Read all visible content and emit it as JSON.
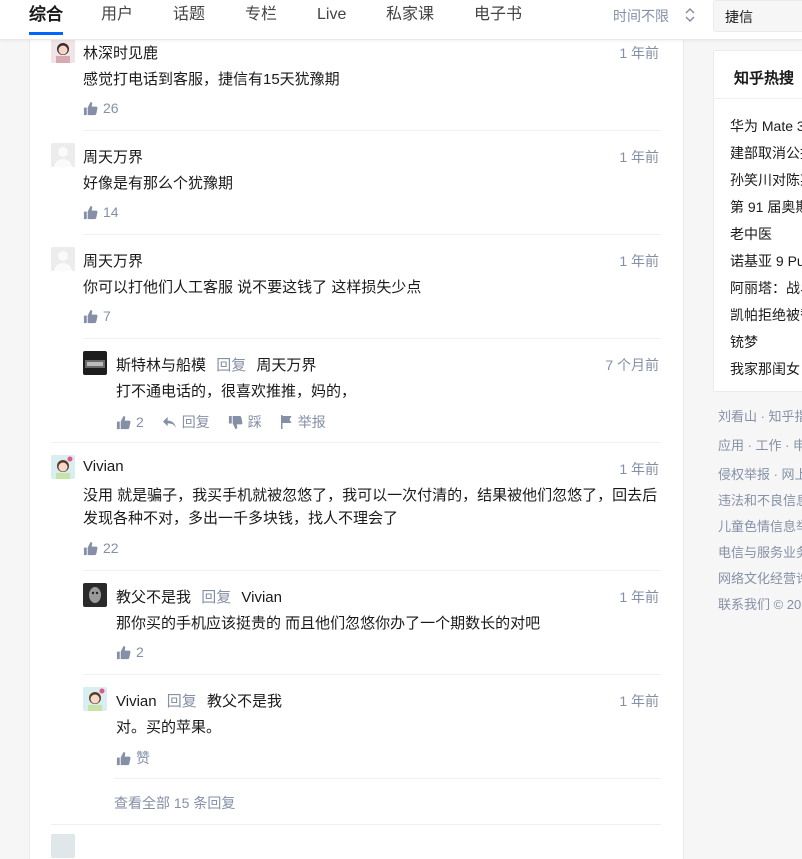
{
  "search_tabs": [
    "综合",
    "用户",
    "话题",
    "专栏",
    "Live",
    "私家课",
    "电子书"
  ],
  "time_filter": "时间不限",
  "search_query": "捷信",
  "comments": [
    {
      "name": "林深时见鹿",
      "time": "1 年前",
      "text": "感觉打电话到客服，捷信有15天犹豫期",
      "likes": "26"
    },
    {
      "name": "周天万界",
      "time": "1 年前",
      "text": "好像是有那么个犹豫期",
      "likes": "14"
    },
    {
      "name": "周天万界",
      "time": "1 年前",
      "text": "你可以打他们人工客服 说不要这钱了 这样损失少点",
      "likes": "7"
    },
    {
      "name": "Vivian",
      "time": "1 年前",
      "text_line1": "没用 就是骗子，我买手机就被忽悠了，我可以一次付清的，结果被他们忽悠了，回去后",
      "text_line2": "发现各种不对，多出一千多块钱，找人不理会了",
      "likes": "22"
    }
  ],
  "replies": [
    {
      "name": "斯特林与船模",
      "reply_word": "回复",
      "to": "周天万界",
      "time": "7 个月前",
      "text": "打不通电话的，很喜欢推推，妈的，",
      "likes": "2",
      "reply_label": "回复",
      "dislike_label": "踩",
      "report_label": "举报"
    },
    {
      "name": "教父不是我",
      "reply_word": "回复",
      "to": "Vivian",
      "time": "1 年前",
      "text": "那你买的手机应该挺贵的 而且他们忽悠你办了一个期数长的对吧",
      "likes": "2"
    },
    {
      "name": "Vivian",
      "reply_word": "回复",
      "to": "教父不是我",
      "time": "1 年前",
      "text": "对。买的苹果。",
      "likes": "赞"
    }
  ],
  "view_all": "查看全部 15 条回复",
  "hot": {
    "title": "知乎热搜",
    "items": [
      "华为 Mate 3",
      "建部取消公摊",
      "孙笑川对陈某",
      "第 91 届奥斯",
      "老中医",
      "诺基亚 9 Pu",
      "阿丽塔：战斗",
      "凯帕拒绝被替",
      "铳梦",
      "我家那闺女"
    ]
  },
  "footer": [
    "刘看山 · 知乎指",
    "应用 · 工作 · 申",
    "侵权举报 · 网上",
    "违法和不良信息",
    "儿童色情信息举",
    "电信与服务业务",
    "网络文化经营许",
    "联系我们 © 20"
  ],
  "colors": {
    "accent": "#0066ff",
    "meta": "#8590a6",
    "text": "#1a1a1a"
  }
}
